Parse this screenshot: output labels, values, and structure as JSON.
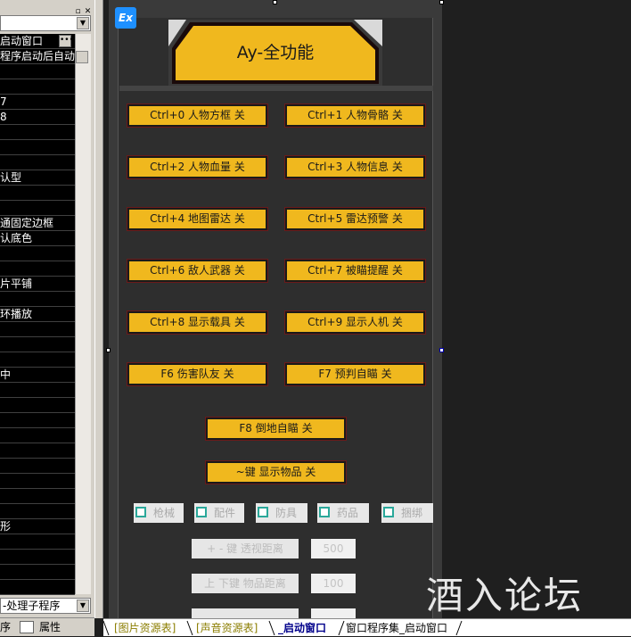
{
  "left_panel": {
    "property_rows": [
      "启动窗口",
      "程序启动后自动",
      "",
      "",
      "7",
      "8",
      "",
      "",
      "",
      "认型",
      "",
      "",
      "通固定边框",
      "认底色",
      "",
      "",
      "片平铺",
      "",
      "环播放",
      "",
      "",
      "",
      "中",
      "",
      "",
      "",
      "",
      "",
      "",
      "",
      "",
      "",
      "形",
      "",
      "",
      "",
      ""
    ],
    "bottom_combo_value": "-处理子程序",
    "bottom_tab_1": "序",
    "bottom_tab_2": "属性"
  },
  "form": {
    "badge": "Ex",
    "header_title_prefix": "Ay",
    "header_title_suffix": "-全功能",
    "function_buttons": [
      "Ctrl+0  人物方框  关",
      "Ctrl+1  人物骨骼  关",
      "Ctrl+2  人物血量  关",
      "Ctrl+3  人物信息  关",
      "Ctrl+4  地图雷达  关",
      "Ctrl+5  雷达预警  关",
      "Ctrl+6  敌人武器  关",
      "Ctrl+7  被瞄提醒  关",
      "Ctrl+8  显示载具  关",
      "Ctrl+9  显示人机  关",
      "F6  伤害队友  关",
      "F7  预判自瞄  关",
      "F8  倒地自瞄  关",
      "~键  显示物品  关"
    ],
    "checkboxes": [
      "枪械",
      "配件",
      "防具",
      "药品",
      "捆绑"
    ],
    "distance_rows": [
      {
        "label": "+ - 键  透视距离",
        "value": "500"
      },
      {
        "label": "上 下键  物品距离",
        "value": "100"
      }
    ]
  },
  "watermark": "酒入论坛",
  "tabs": [
    "[图片资源表]",
    "[声音资源表]",
    "_启动窗口",
    "窗口程序集_启动窗口"
  ],
  "colors": {
    "button_fill": "#f0b81e",
    "checkbox_border": "#2aa89a",
    "badge_blue": "#1e90ff"
  }
}
